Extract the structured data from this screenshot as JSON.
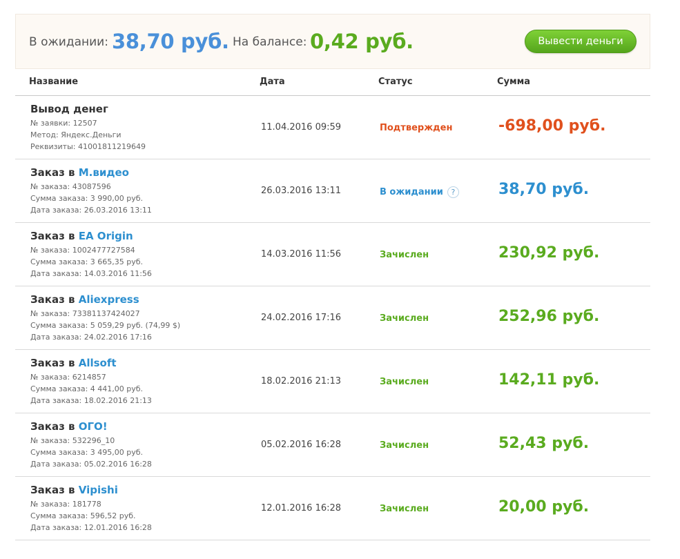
{
  "summary": {
    "pending_label": "В ожидании:",
    "pending_amount": "38,70 руб.",
    "balance_label": "На балансе:",
    "balance_amount": "0,42 руб.",
    "withdraw_button": "Вывести деньги"
  },
  "table": {
    "headers": {
      "name": "Название",
      "date": "Дата",
      "status": "Статус",
      "sum": "Сумма"
    },
    "rows": [
      {
        "title_prefix": "Вывод денег",
        "shop": "",
        "details": [
          "№ заявки: 12507",
          "Метод: Яндекс.Деньги",
          "Реквизиты: 41001811219649"
        ],
        "date": "11.04.2016 09:59",
        "status": "Подтвержден",
        "status_kind": "confirmed",
        "sum": "-698,00 руб."
      },
      {
        "title_prefix": "Заказ в ",
        "shop": "М.видео",
        "details": [
          "№ заказа: 43087596",
          "Сумма заказа: 3 990,00 руб.",
          "Дата заказа: 26.03.2016 13:11"
        ],
        "date": "26.03.2016 13:11",
        "status": "В ожидании",
        "status_kind": "pending",
        "help": "?",
        "sum": "38,70 руб."
      },
      {
        "title_prefix": "Заказ в ",
        "shop": "EA Origin",
        "details": [
          "№ заказа: 1002477727584",
          "Сумма заказа: 3 665,35 руб.",
          "Дата заказа: 14.03.2016 11:56"
        ],
        "date": "14.03.2016 11:56",
        "status": "Зачислен",
        "status_kind": "credited",
        "sum": "230,92 руб."
      },
      {
        "title_prefix": "Заказ в ",
        "shop": "Aliexpress",
        "details": [
          "№ заказа: 73381137424027",
          "Сумма заказа: 5 059,29 руб. (74,99 $)",
          "Дата заказа: 24.02.2016 17:16"
        ],
        "date": "24.02.2016 17:16",
        "status": "Зачислен",
        "status_kind": "credited",
        "sum": "252,96 руб."
      },
      {
        "title_prefix": "Заказ в ",
        "shop": "Allsoft",
        "details": [
          "№ заказа: 6214857",
          "Сумма заказа: 4 441,00 руб.",
          "Дата заказа: 18.02.2016 21:13"
        ],
        "date": "18.02.2016 21:13",
        "status": "Зачислен",
        "status_kind": "credited",
        "sum": "142,11 руб."
      },
      {
        "title_prefix": "Заказ в ",
        "shop": "ОГО!",
        "details": [
          "№ заказа: 532296_10",
          "Сумма заказа: 3 495,00 руб.",
          "Дата заказа: 05.02.2016 16:28"
        ],
        "date": "05.02.2016 16:28",
        "status": "Зачислен",
        "status_kind": "credited",
        "sum": "52,43 руб."
      },
      {
        "title_prefix": "Заказ в ",
        "shop": "Vipishi",
        "details": [
          "№ заказа: 181778",
          "Сумма заказа: 596,52 руб.",
          "Дата заказа: 12.01.2016 16:28"
        ],
        "date": "12.01.2016 16:28",
        "status": "Зачислен",
        "status_kind": "credited",
        "sum": "20,00 руб."
      }
    ]
  },
  "colors": {
    "pending_blue": "#2d8fcf",
    "pending_summary_blue": "#4a90d9",
    "credited_green": "#5aab1f",
    "confirmed_orange": "#e0501d",
    "shop_link_blue": "#2d8fcf",
    "button_green": "#6cc22b"
  }
}
